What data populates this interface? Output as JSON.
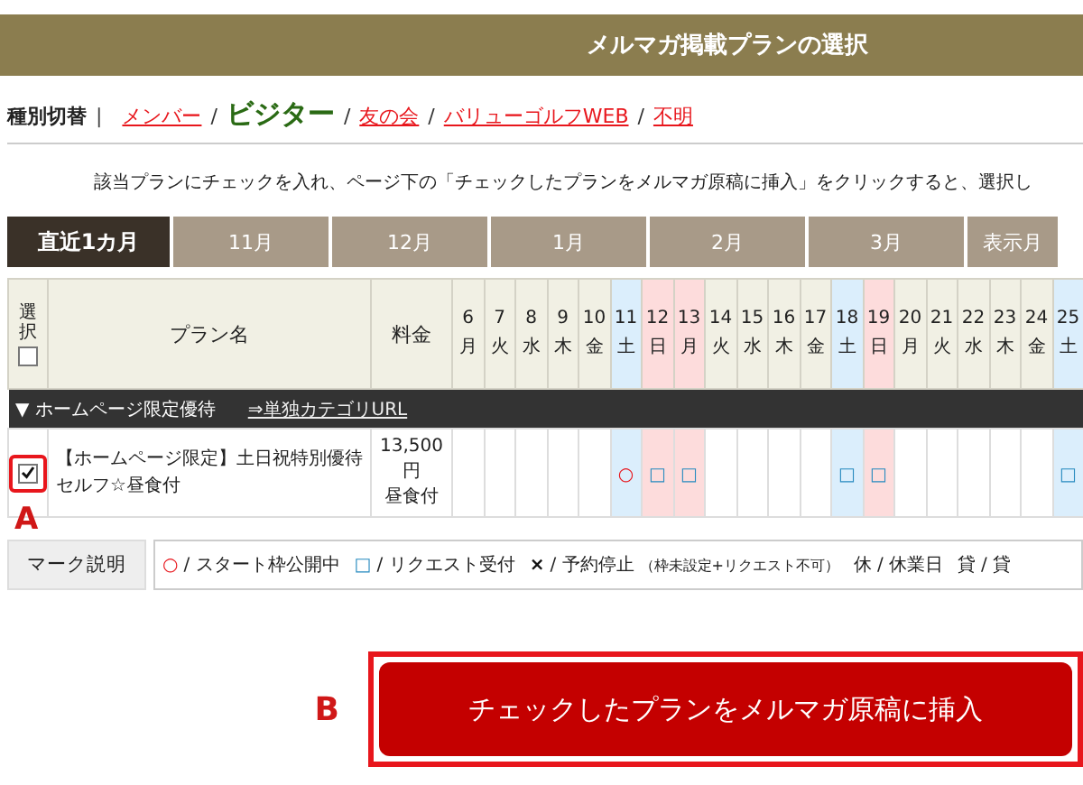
{
  "header": {
    "title": "メルマガ掲載プランの選択"
  },
  "type_switch": {
    "label": "種別切替",
    "separator": "|",
    "divider": "/",
    "items": [
      {
        "label": "メンバー",
        "selected": false
      },
      {
        "label": "ビジター",
        "selected": true
      },
      {
        "label": "友の会",
        "selected": false
      },
      {
        "label": "バリューゴルフWEB",
        "selected": false
      },
      {
        "label": "不明",
        "selected": false
      }
    ]
  },
  "instruction": "該当プランにチェックを入れ、ページ下の「チェックしたプランをメルマガ原稿に挿入」をクリックすると、選択し",
  "month_tabs": [
    {
      "label": "直近1カ月",
      "selected": true
    },
    {
      "label": "11月",
      "selected": false
    },
    {
      "label": "12月",
      "selected": false
    },
    {
      "label": "1月",
      "selected": false
    },
    {
      "label": "2月",
      "selected": false
    },
    {
      "label": "3月",
      "selected": false
    },
    {
      "label": "表示月",
      "selected": false
    }
  ],
  "table": {
    "columns": {
      "select": "選択",
      "plan": "プラン名",
      "price": "料金"
    },
    "select_all_checked": false,
    "days": [
      {
        "date": "6",
        "weekday": "月",
        "kind": "weekday"
      },
      {
        "date": "7",
        "weekday": "火",
        "kind": "weekday"
      },
      {
        "date": "8",
        "weekday": "水",
        "kind": "weekday"
      },
      {
        "date": "9",
        "weekday": "木",
        "kind": "weekday"
      },
      {
        "date": "10",
        "weekday": "金",
        "kind": "weekday"
      },
      {
        "date": "11",
        "weekday": "土",
        "kind": "saturday"
      },
      {
        "date": "12",
        "weekday": "日",
        "kind": "holiday"
      },
      {
        "date": "13",
        "weekday": "月",
        "kind": "holiday"
      },
      {
        "date": "14",
        "weekday": "火",
        "kind": "weekday"
      },
      {
        "date": "15",
        "weekday": "水",
        "kind": "weekday"
      },
      {
        "date": "16",
        "weekday": "木",
        "kind": "weekday"
      },
      {
        "date": "17",
        "weekday": "金",
        "kind": "weekday"
      },
      {
        "date": "18",
        "weekday": "土",
        "kind": "saturday"
      },
      {
        "date": "19",
        "weekday": "日",
        "kind": "holiday"
      },
      {
        "date": "20",
        "weekday": "月",
        "kind": "weekday"
      },
      {
        "date": "21",
        "weekday": "火",
        "kind": "weekday"
      },
      {
        "date": "22",
        "weekday": "水",
        "kind": "weekday"
      },
      {
        "date": "23",
        "weekday": "木",
        "kind": "weekday"
      },
      {
        "date": "24",
        "weekday": "金",
        "kind": "weekday"
      },
      {
        "date": "25",
        "weekday": "土",
        "kind": "saturday"
      }
    ],
    "category": {
      "title": "▼ ホームページ限定優待",
      "link": "⇒単独カテゴリURL"
    },
    "rows": [
      {
        "checked": true,
        "annotation": "A",
        "name": "【ホームページ限定】土日祝特別優待セルフ☆昼食付",
        "price_lines": [
          "13,500",
          "円",
          "昼食付"
        ],
        "cells": [
          {
            "kind": "empty"
          },
          {
            "kind": "empty"
          },
          {
            "kind": "empty"
          },
          {
            "kind": "empty"
          },
          {
            "kind": "empty"
          },
          {
            "kind": "open",
            "symbol": "○"
          },
          {
            "kind": "request",
            "symbol": "□"
          },
          {
            "kind": "request",
            "symbol": "□"
          },
          {
            "kind": "empty"
          },
          {
            "kind": "empty"
          },
          {
            "kind": "empty"
          },
          {
            "kind": "empty"
          },
          {
            "kind": "request",
            "symbol": "□"
          },
          {
            "kind": "request",
            "symbol": "□"
          },
          {
            "kind": "empty"
          },
          {
            "kind": "empty"
          },
          {
            "kind": "empty"
          },
          {
            "kind": "empty"
          },
          {
            "kind": "empty"
          },
          {
            "kind": "request",
            "symbol": "□"
          }
        ]
      }
    ]
  },
  "legend": {
    "button": "マーク説明",
    "items": [
      {
        "kind": "open",
        "symbol": "○",
        "text": "/ スタート枠公開中"
      },
      {
        "kind": "request",
        "symbol": "□",
        "text": "/ リクエスト受付"
      },
      {
        "kind": "stop",
        "symbol": "×",
        "text": "/ 予約停止",
        "note": "（枠未設定+リクエスト不可）"
      },
      {
        "kind": "closed",
        "symbol": "休",
        "text": "/ 休業日"
      },
      {
        "kind": "reserved",
        "symbol": "貸",
        "text": "/ 貸"
      }
    ]
  },
  "submit": {
    "label": "チェックしたプランをメルマガ原稿に挿入",
    "annotation": "B"
  }
}
